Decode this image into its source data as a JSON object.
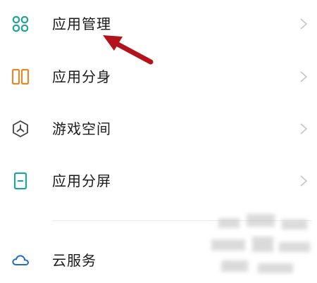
{
  "settings_list": {
    "items": [
      {
        "label": "应用管理",
        "icon": "app-grid-icon"
      },
      {
        "label": "应用分身",
        "icon": "app-clone-icon"
      },
      {
        "label": "游戏空间",
        "icon": "game-space-icon"
      },
      {
        "label": "应用分屏",
        "icon": "split-screen-icon"
      }
    ],
    "cloud": {
      "label": "云服务",
      "icon": "cloud-icon"
    }
  },
  "colors": {
    "teal": "#1fa39a",
    "orange": "#e08a2e",
    "arrow_red": "#b3131b",
    "chevron": "#c4c4c4",
    "text": "#1a1a1a"
  }
}
